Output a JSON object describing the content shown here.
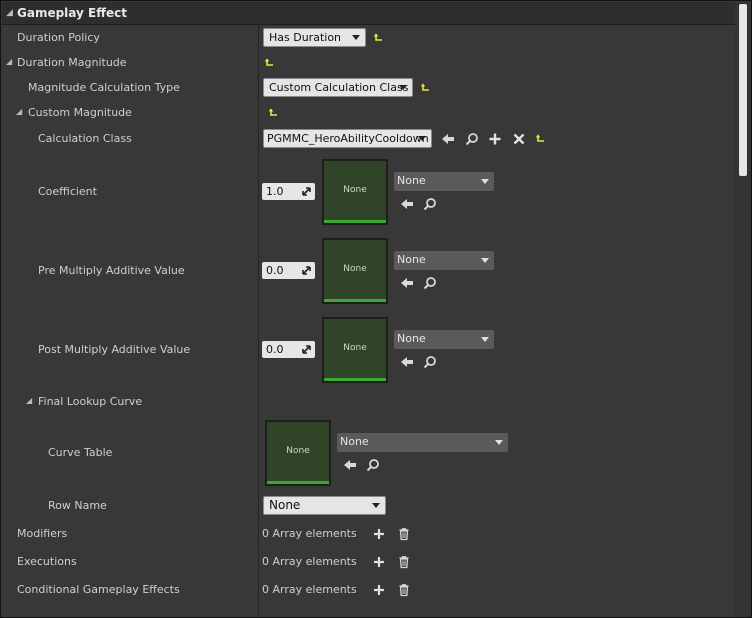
{
  "panel": {
    "title": "Gameplay Effect"
  },
  "rows": {
    "duration_policy": {
      "label": "Duration Policy",
      "value": "Has Duration"
    },
    "duration_magnitude": {
      "label": "Duration Magnitude"
    },
    "magnitude_calc_type": {
      "label": "Magnitude Calculation Type",
      "value": "Custom Calculation Class"
    },
    "custom_magnitude": {
      "label": "Custom Magnitude"
    },
    "calculation_class": {
      "label": "Calculation Class",
      "value": "PGMMC_HeroAbilityCooldown"
    },
    "coefficient": {
      "label": "Coefficient",
      "value": "1.0",
      "thumb": "None",
      "curve": "None"
    },
    "pre_multiply": {
      "label": "Pre Multiply Additive Value",
      "value": "0.0",
      "thumb": "None",
      "curve": "None"
    },
    "post_multiply": {
      "label": "Post Multiply Additive Value",
      "value": "0.0",
      "thumb": "None",
      "curve": "None"
    },
    "final_lookup_curve": {
      "label": "Final Lookup Curve"
    },
    "curve_table": {
      "label": "Curve Table",
      "thumb": "None",
      "value": "None"
    },
    "row_name": {
      "label": "Row Name",
      "value": "None"
    },
    "modifiers": {
      "label": "Modifiers",
      "value": "0 Array elements"
    },
    "executions": {
      "label": "Executions",
      "value": "0 Array elements"
    },
    "conditional_effects": {
      "label": "Conditional Gameplay Effects",
      "value": "0 Array elements"
    }
  },
  "colors": {
    "panel_bg": "#383838",
    "reset_arrow": "#e8e83c",
    "thumb_bg": "#2f4429",
    "thumb_bar": "#3aa832"
  }
}
